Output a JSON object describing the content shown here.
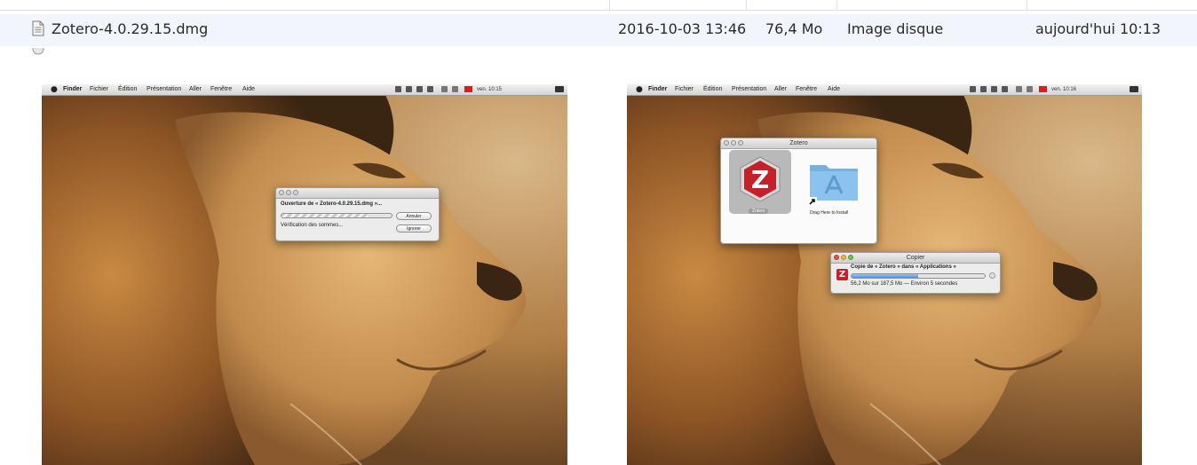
{
  "finder_list": {
    "selected_file": {
      "name": "Zotero-4.0.29.15.dmg",
      "date_modified": "2016-10-03 13:46",
      "size": "76,4 Mo",
      "kind": "Image disque",
      "date_added": "aujourd'hui 10:13"
    }
  },
  "colors": {
    "selected_row": "#f2f5fb",
    "zotero_red": "#c6212b",
    "progress_blue": "#4e93dc"
  },
  "screenshot_left": {
    "menubar": {
      "items": [
        "Finder",
        "Fichier",
        "Édition",
        "Présentation",
        "Aller",
        "Fenêtre",
        "Aide"
      ],
      "clock": "ven. 10:15"
    },
    "opening_dialog": {
      "title_text": "Ouverture de « Zotero-4.0.29.15.dmg »...",
      "status_text": "Vérification des sommes...",
      "cancel_label": "Annuler",
      "skip_label": "Ignorer",
      "progress": 0.78
    }
  },
  "screenshot_right": {
    "menubar": {
      "items": [
        "Finder",
        "Fichier",
        "Édition",
        "Présentation",
        "Aller",
        "Fenêtre",
        "Aide"
      ],
      "clock": "ven. 10:16"
    },
    "dmg_window": {
      "title": "Zotero",
      "app_label": "Zotero",
      "app_icon_letter": "Z",
      "drop_label": "Drag Here to Install"
    },
    "copy_dialog": {
      "title": "Copier",
      "copy_text": "Copie de « Zotero » dans « Applications »",
      "status_text": "56,2 Mo sur 187,5 Mo — Environ 5 secondes",
      "icon_letter": "Z",
      "progress": 0.5
    }
  }
}
